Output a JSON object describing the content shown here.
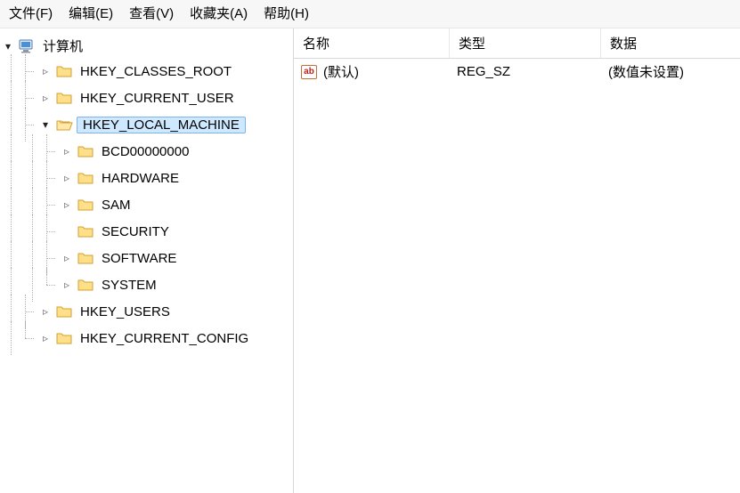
{
  "menu": {
    "file": "文件(F)",
    "edit": "编辑(E)",
    "view": "查看(V)",
    "favorites": "收藏夹(A)",
    "help": "帮助(H)"
  },
  "tree": {
    "root": "计算机",
    "hkey_classes_root": "HKEY_CLASSES_ROOT",
    "hkey_current_user": "HKEY_CURRENT_USER",
    "hkey_local_machine": "HKEY_LOCAL_MACHINE",
    "hklm_children": {
      "bcd": "BCD00000000",
      "hardware": "HARDWARE",
      "sam": "SAM",
      "security": "SECURITY",
      "software": "SOFTWARE",
      "system": "SYSTEM"
    },
    "hkey_users": "HKEY_USERS",
    "hkey_current_config": "HKEY_CURRENT_CONFIG"
  },
  "list": {
    "headers": {
      "name": "名称",
      "type": "类型",
      "data": "数据"
    },
    "rows": [
      {
        "name": "(默认)",
        "type": "REG_SZ",
        "data": "(数值未设置)"
      }
    ]
  }
}
